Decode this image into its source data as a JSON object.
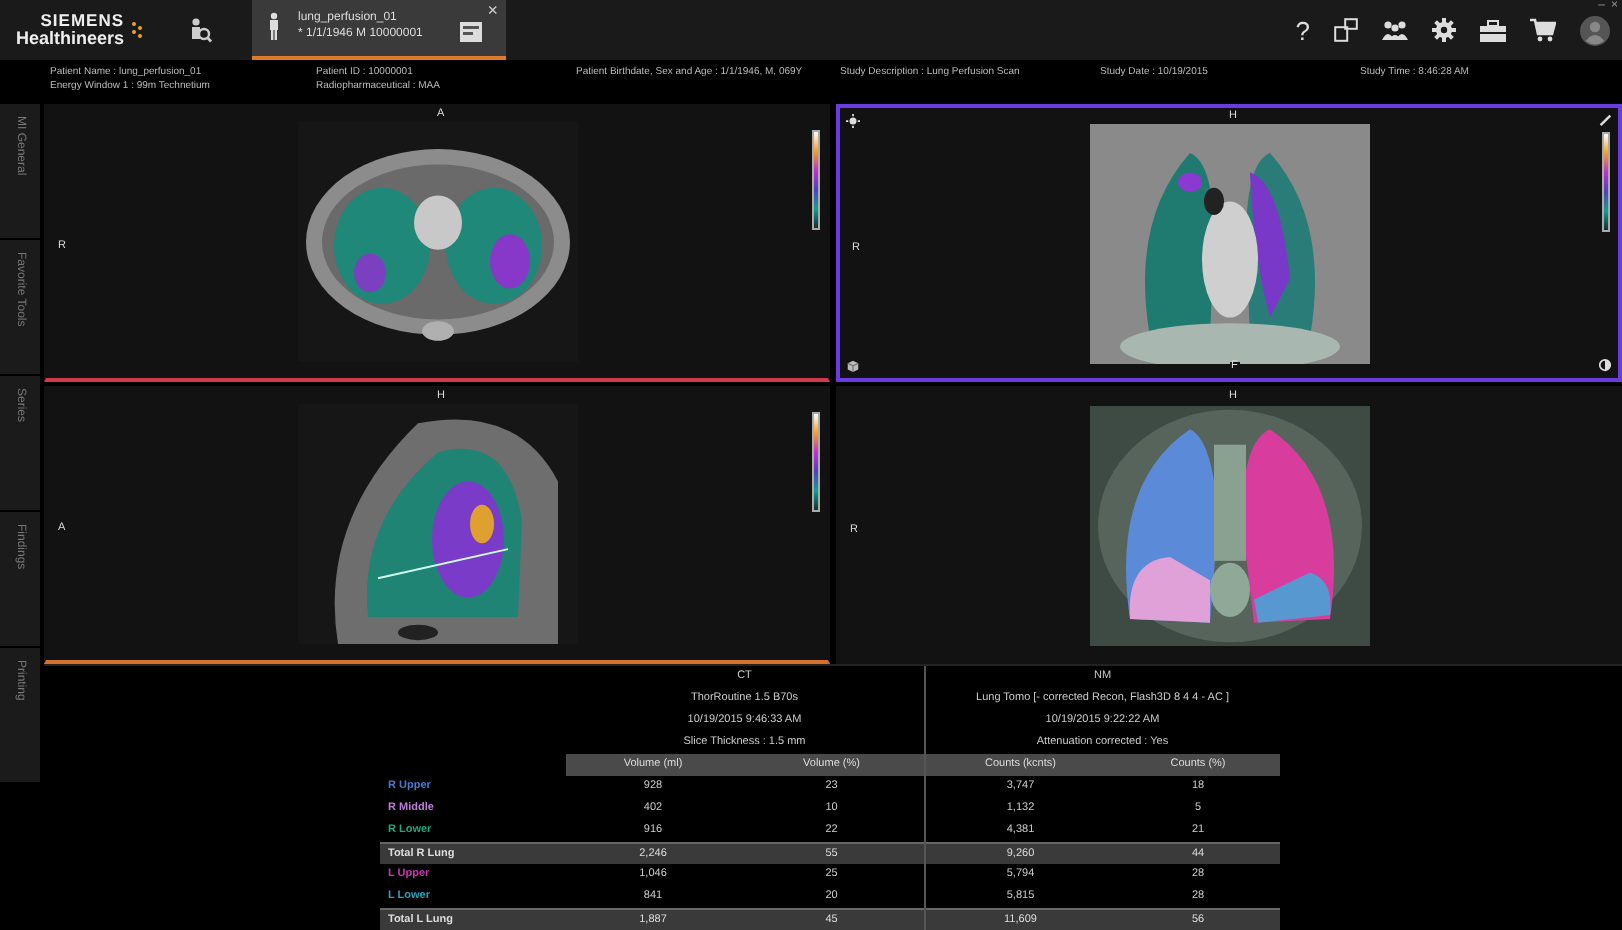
{
  "header": {
    "logo": [
      "SIEMENS",
      "Healthineers"
    ],
    "tab": {
      "title": "lung_perfusion_01",
      "subtitle": "* 1/1/1946 M 10000001",
      "close": "×",
      "selected": true
    },
    "help": "?",
    "window_controls": [
      "–",
      "×"
    ]
  },
  "info_bar": [
    [
      "Patient Name : lung_perfusion_01",
      "Energy Window 1 : 99m Technetium"
    ],
    [
      "Patient ID : 10000001",
      "Radiopharmaceutical : MAA"
    ],
    [
      "Patient Birthdate, Sex and Age : 1/1/1946, M, 069Y"
    ],
    [
      "Study Description : Lung Perfusion Scan"
    ],
    [
      "Study Date : 10/19/2015"
    ],
    [
      "Study Time : 8:46:28 AM"
    ]
  ],
  "sidebar": {
    "items": [
      {
        "label": "MI General",
        "selected": false
      },
      {
        "label": "Favorite Tools",
        "selected": false
      },
      {
        "label": "Series",
        "selected": false
      },
      {
        "label": "Findings",
        "selected": false
      },
      {
        "label": "Printing",
        "selected": false
      }
    ]
  },
  "viewports": [
    {
      "top": "A",
      "left": "R",
      "colorbar": true,
      "selected": false
    },
    {
      "top": "H",
      "left": "R",
      "bottom": "F",
      "colorbar": true,
      "selected": true
    },
    {
      "top": "H",
      "left": "A",
      "colorbar": true,
      "selected": false
    },
    {
      "top": "H",
      "left": "R",
      "colorbar": false,
      "selected": false
    }
  ],
  "results": {
    "sections": [
      {
        "lines": [
          "CT",
          "ThorRoutine 1.5 B70s",
          "10/19/2015 9:46:33 AM",
          "Slice Thickness : 1.5 mm"
        ]
      },
      {
        "lines": [
          "NM",
          "Lung Tomo [- corrected Recon, Flash3D 8 4 4 - AC ]",
          "10/19/2015 9:22:22 AM",
          "Attenuation corrected : Yes"
        ]
      }
    ],
    "columns": [
      "Volume (ml)",
      "Volume (%)",
      "Counts (kcnts)",
      "Counts (%)"
    ],
    "rows": [
      {
        "kind": "region",
        "label": "R Upper",
        "color": "#4a7ad0",
        "cells": [
          "928",
          "23",
          "3,747",
          "18"
        ]
      },
      {
        "kind": "region",
        "label": "R Middle",
        "color": "#c07ad8",
        "cells": [
          "402",
          "10",
          "1,132",
          "5"
        ]
      },
      {
        "kind": "region",
        "label": "R Lower",
        "color": "#20a878",
        "cells": [
          "916",
          "22",
          "4,381",
          "21"
        ]
      },
      {
        "kind": "total",
        "label": "Total R Lung",
        "cells": [
          "2,246",
          "55",
          "9,260",
          "44"
        ]
      },
      {
        "kind": "region",
        "label": "L Upper",
        "color": "#c838b0",
        "cells": [
          "1,046",
          "25",
          "5,794",
          "28"
        ]
      },
      {
        "kind": "region",
        "label": "L Lower",
        "color": "#30a0b8",
        "cells": [
          "841",
          "20",
          "5,815",
          "28"
        ]
      },
      {
        "kind": "total",
        "label": "Total L Lung",
        "cells": [
          "1,887",
          "45",
          "11,609",
          "56"
        ]
      }
    ]
  }
}
